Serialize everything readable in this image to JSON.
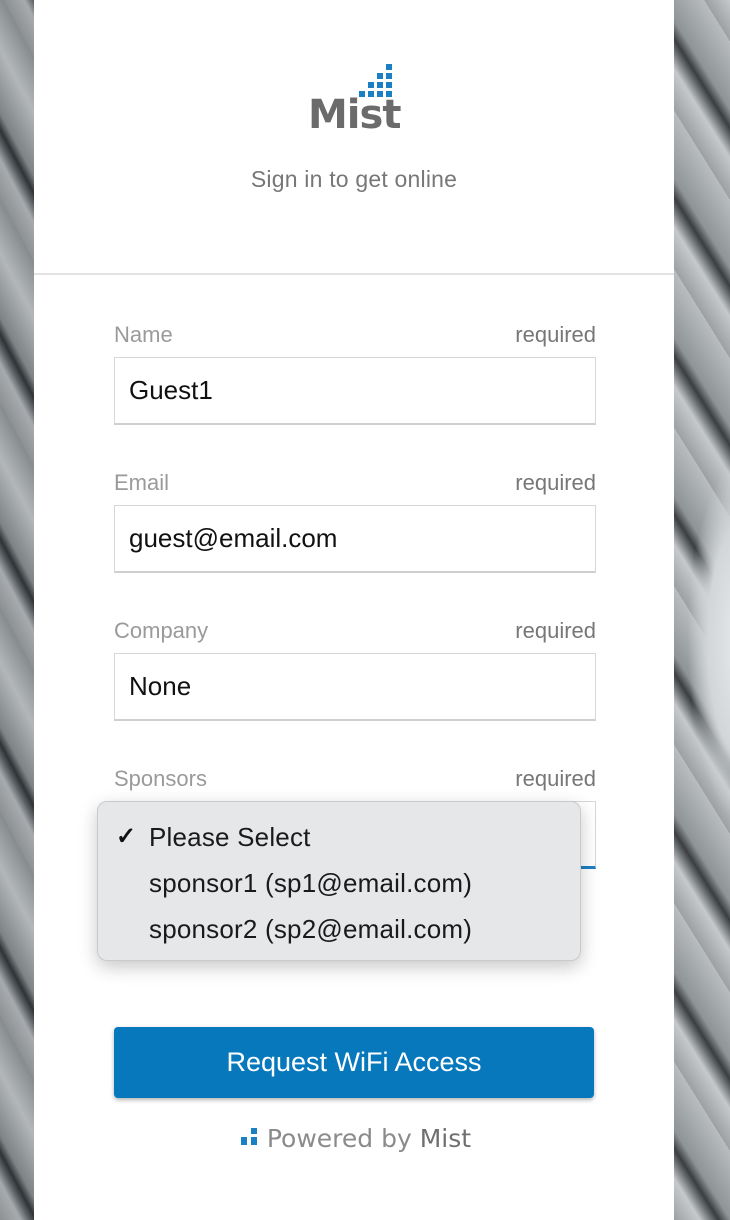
{
  "header": {
    "logo_text": "Mist",
    "tagline": "Sign in to get online"
  },
  "form": {
    "fields": [
      {
        "label": "Name",
        "required": "required",
        "value": "Guest1"
      },
      {
        "label": "Email",
        "required": "required",
        "value": "guest@email.com"
      },
      {
        "label": "Company",
        "required": "required",
        "value": "None"
      },
      {
        "label": "Sponsors",
        "required": "required"
      }
    ],
    "sponsors_dropdown": {
      "selected": "Please Select",
      "options": [
        "Please Select",
        "sponsor1 (sp1@email.com)",
        "sponsor2 (sp2@email.com)"
      ]
    },
    "submit_label": "Request WiFi Access"
  },
  "footer": {
    "powered_prefix": "Powered by",
    "powered_brand": "Mist"
  },
  "colors": {
    "accent": "#0878bd",
    "brand_blue": "#1b7fc4"
  },
  "icons": {
    "logo": "mist-logo-icon",
    "check": "checkmark-icon",
    "footer_logo": "mist-mini-logo-icon"
  }
}
